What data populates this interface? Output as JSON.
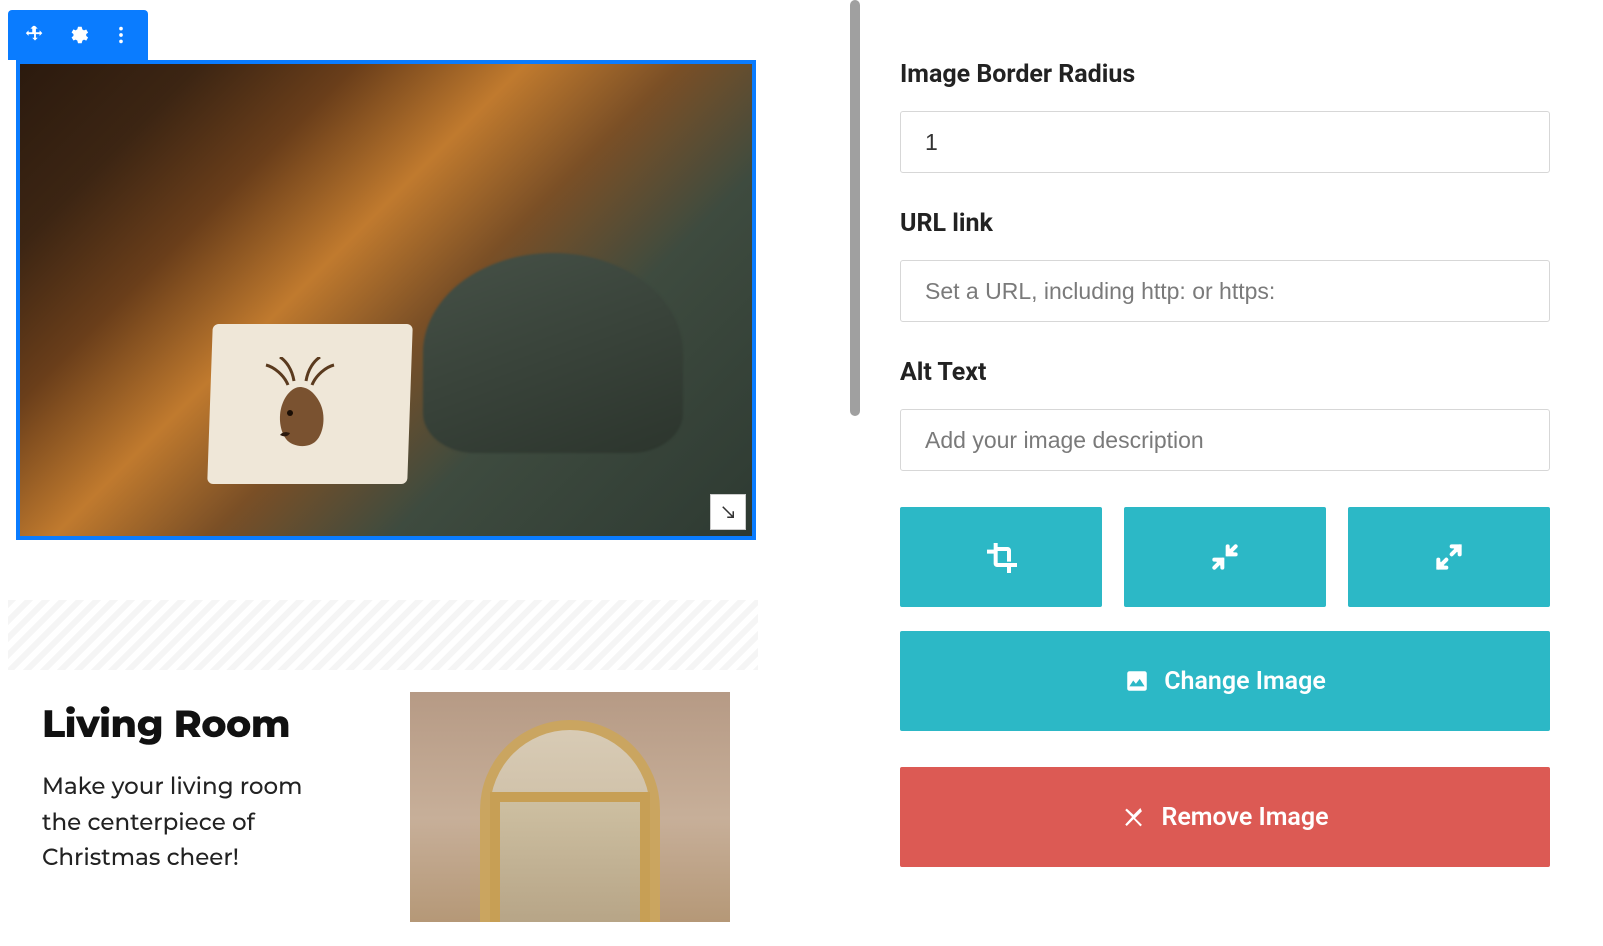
{
  "panel": {
    "border_radius": {
      "label": "Image Border Radius",
      "value": "1"
    },
    "url_link": {
      "label": "URL link",
      "placeholder": "Set a URL, including http: or https:"
    },
    "alt_text": {
      "label": "Alt Text",
      "placeholder": "Add your image description"
    },
    "change_image": "Change Image",
    "remove_image": "Remove Image"
  },
  "content": {
    "living_room": {
      "title": "Living Room",
      "body": "Make your living room the centerpiece of Christmas cheer!"
    }
  },
  "colors": {
    "accent": "#0a7cff",
    "teal": "#2cb8c6",
    "danger": "#dc5a54"
  },
  "icons": {
    "move": "move-icon",
    "gear": "gear-icon",
    "more": "more-vert-icon",
    "resize": "resize-se-icon",
    "crop": "crop-icon",
    "shrink": "compress-icon",
    "expand": "expand-icon",
    "image": "image-icon",
    "close": "close-icon"
  }
}
